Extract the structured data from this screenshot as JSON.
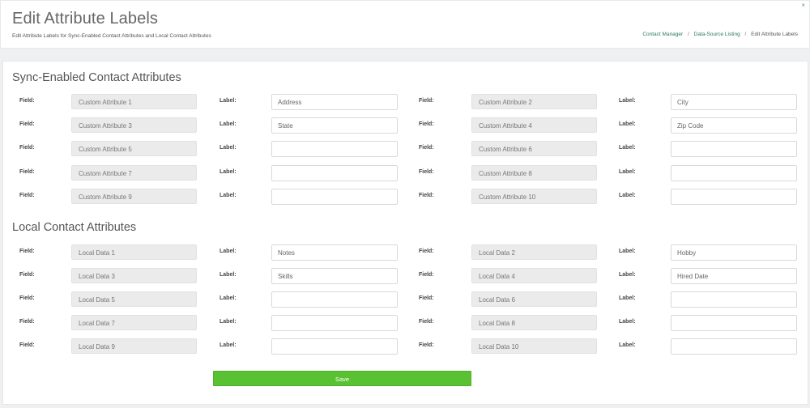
{
  "header": {
    "title": "Edit Attribute Labels",
    "subtitle": "Edit Attribute Labels for Sync-Enabled Contact Attributes and Local Contact Attributes",
    "close_glyph": "×",
    "breadcrumb": [
      {
        "label": "Contact Manager",
        "link": true
      },
      {
        "label": "Data-Source Listing",
        "link": true
      },
      {
        "label": "Edit Attribute Labels",
        "link": false
      }
    ],
    "separator": "/"
  },
  "field_label": "Field:",
  "label_label": "Label:",
  "sections": [
    {
      "title": "Sync-Enabled Contact Attributes",
      "rows": [
        {
          "left": {
            "field": "Custom Attribute 1",
            "label": "Address"
          },
          "right": {
            "field": "Custom Attribute 2",
            "label": "City"
          }
        },
        {
          "left": {
            "field": "Custom Attribute 3",
            "label": "State"
          },
          "right": {
            "field": "Custom Attribute 4",
            "label": "Zip Code"
          }
        },
        {
          "left": {
            "field": "Custom Attribute 5",
            "label": ""
          },
          "right": {
            "field": "Custom Attribute 6",
            "label": ""
          }
        },
        {
          "left": {
            "field": "Custom Attribute 7",
            "label": ""
          },
          "right": {
            "field": "Custom Attribute 8",
            "label": ""
          }
        },
        {
          "left": {
            "field": "Custom Attribute 9",
            "label": ""
          },
          "right": {
            "field": "Custom Attribute 10",
            "label": ""
          }
        }
      ]
    },
    {
      "title": "Local Contact Attributes",
      "rows": [
        {
          "left": {
            "field": "Local Data 1",
            "label": "Notes"
          },
          "right": {
            "field": "Local Data 2",
            "label": "Hobby"
          }
        },
        {
          "left": {
            "field": "Local Data 3",
            "label": "Skills"
          },
          "right": {
            "field": "Local Data 4",
            "label": "Hired Date"
          }
        },
        {
          "left": {
            "field": "Local Data 5",
            "label": ""
          },
          "right": {
            "field": "Local Data 6",
            "label": ""
          }
        },
        {
          "left": {
            "field": "Local Data 7",
            "label": ""
          },
          "right": {
            "field": "Local Data 8",
            "label": ""
          }
        },
        {
          "left": {
            "field": "Local Data 9",
            "label": ""
          },
          "right": {
            "field": "Local Data 10",
            "label": ""
          }
        }
      ]
    }
  ],
  "save_label": "Save",
  "colors": {
    "accent_green": "#5ac232",
    "breadcrumb_link": "#2a7a57",
    "field_bg": "#ebebeb"
  }
}
